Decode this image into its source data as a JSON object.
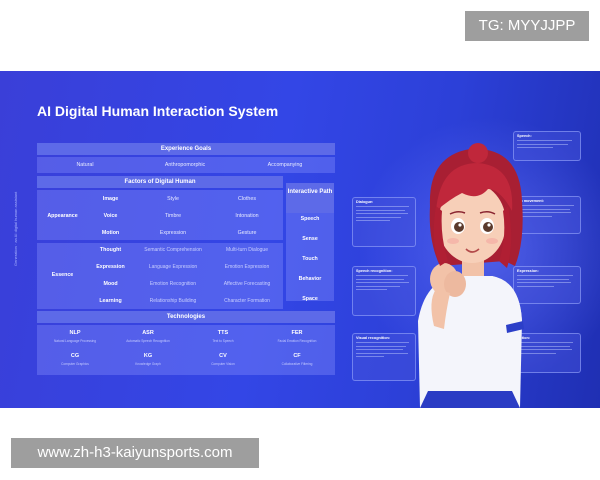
{
  "watermark_top": "TG: MYYJJPP",
  "watermark_bottom": "www.zh-h3-kaiyunsports.com",
  "banner": {
    "title": "AI Digital Human Interaction System",
    "vertical_text": "Generation · an AI digital human assistant",
    "experience_goals": {
      "heading": "Experience Goals",
      "items": [
        "Natural",
        "Anthropomorphic",
        "Accompanying"
      ]
    },
    "factors": {
      "heading": "Factors of Digital Human",
      "appearance": "Appearance",
      "essence": "Essence",
      "row_labels": [
        "Image",
        "Voice",
        "Motion",
        "Thought",
        "Expression",
        "Mood",
        "Learning"
      ],
      "col2": [
        "Style",
        "Timbre",
        "Expression",
        "Semantic Comprehension",
        "Language Expression",
        "Emotion Recognition",
        "Relationship Building"
      ],
      "col3": [
        "Clothes",
        "Intonation",
        "Gesture",
        "Multi-turn Dialogue",
        "Emotion Expression",
        "Affective Forecasting",
        "Character Formation"
      ]
    },
    "interactive_path": {
      "heading": "Interactive Path",
      "items": [
        "Speech",
        "Sense",
        "Touch",
        "Behavior",
        "Space"
      ]
    },
    "technologies": {
      "heading": "Technologies",
      "items": [
        {
          "name": "NLP",
          "sub": "Natural Language Processing"
        },
        {
          "name": "ASR",
          "sub": "Automatic Speech Recognition"
        },
        {
          "name": "TTS",
          "sub": "Text to Speech"
        },
        {
          "name": "FER",
          "sub": "Facial Emotion Recognition"
        },
        {
          "name": "CG",
          "sub": "Computer Graphics"
        },
        {
          "name": "KG",
          "sub": "Knowledge Graph"
        },
        {
          "name": "CV",
          "sub": "Computer Vision"
        },
        {
          "name": "CF",
          "sub": "Collaborative Filtering"
        }
      ]
    },
    "cards": {
      "dialogue": "Dialogue:",
      "speech_recognition": "Speech recognition:",
      "visual_recognition": "Visual recognition:",
      "speech": "Speech:",
      "lip_movement": "Lip movement:",
      "expression": "Expression:",
      "action": "Action:"
    },
    "colors": {
      "accent": "#5d6ae8",
      "background": "#3346e6",
      "hair": "#c0273b"
    }
  }
}
